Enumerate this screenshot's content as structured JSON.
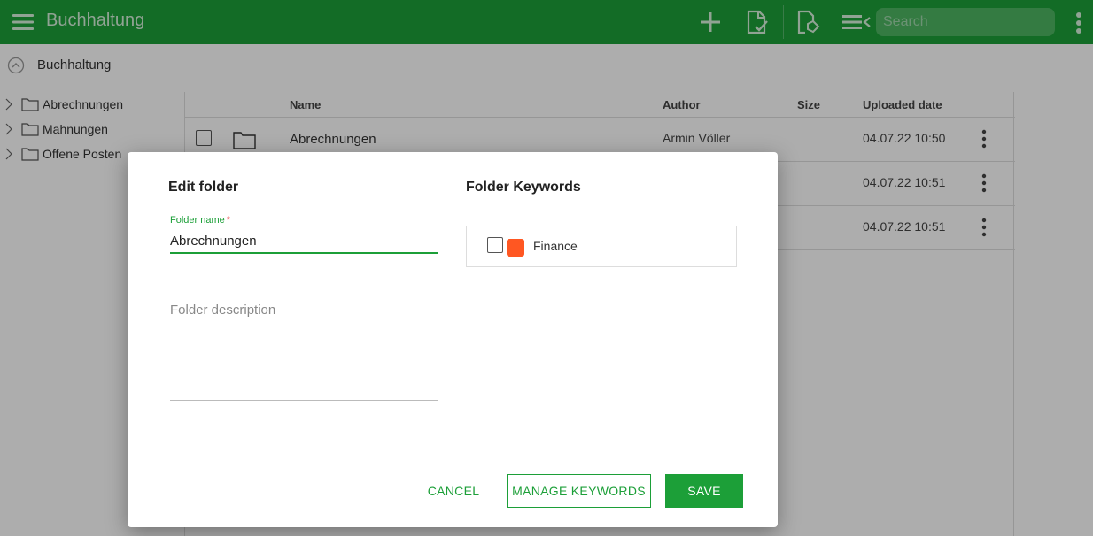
{
  "app": {
    "title": "Buchhaltung",
    "search_placeholder": "Search",
    "accent_color": "#1c9f38"
  },
  "toolbar": {
    "icons": [
      "add-icon",
      "document-check-icon",
      "document-tag-icon",
      "list-view-icon",
      "more-vert-icon"
    ]
  },
  "breadcrumb": {
    "current": "Buchhaltung"
  },
  "tree": {
    "items": [
      {
        "label": "Abrechnungen"
      },
      {
        "label": "Mahnungen"
      },
      {
        "label": "Offene Posten"
      }
    ]
  },
  "table": {
    "columns": {
      "name": "Name",
      "author": "Author",
      "size": "Size",
      "uploaded": "Uploaded date"
    },
    "rows": [
      {
        "name": "Abrechnungen",
        "author": "Armin Völler",
        "size": "",
        "date": "04.07.22 10:50"
      },
      {
        "name": "",
        "author": "",
        "size": "",
        "date": "04.07.22 10:51"
      },
      {
        "name": "",
        "author": "",
        "size": "",
        "date": "04.07.22 10:51"
      }
    ]
  },
  "dialog": {
    "title": "Edit folder",
    "name_label": "Folder name",
    "required_mark": "*",
    "name_value": "Abrechnungen",
    "description_placeholder": "Folder description",
    "keywords_title": "Folder Keywords",
    "keywords": [
      {
        "label": "Finance",
        "color": "#ff5722",
        "checked": false
      }
    ],
    "cancel_label": "CANCEL",
    "manage_label": "MANAGE KEYWORDS",
    "save_label": "SAVE"
  }
}
